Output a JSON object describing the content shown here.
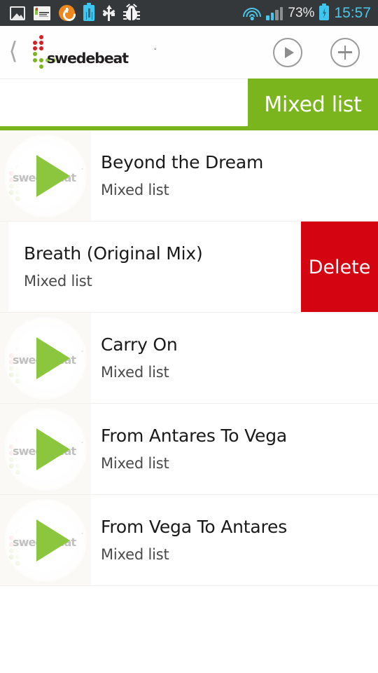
{
  "status_bar": {
    "icons_left": [
      "gallery-icon",
      "screenshot-icon",
      "sync-circle-icon",
      "usb-battery-icon",
      "usb-icon",
      "debug-bug-icon"
    ],
    "wifi": "wifi-icon",
    "signal": {
      "name": "signal-bars-icon",
      "bars_total": 4,
      "bars_filled": 2
    },
    "battery_percent": "73%",
    "battery_icon": "battery-charging-icon",
    "time": "15:57",
    "background": "#34383b",
    "accent": "#4cc6e8"
  },
  "header": {
    "back_icon": "chevron-left-icon",
    "brand": "swedebeat",
    "brand_registered": "°",
    "play_button": "play-circle-icon",
    "add_button": "plus-circle-icon"
  },
  "tabs": {
    "active_label": "Mixed list",
    "accent": "#7ab51d"
  },
  "tracks": [
    {
      "title": "Beyond the Dream",
      "subtitle": "Mixed list",
      "swiped": false
    },
    {
      "title": "Breath (Original Mix)",
      "subtitle": "Mixed list",
      "swiped": true
    },
    {
      "title": "Carry On",
      "subtitle": "Mixed list",
      "swiped": false
    },
    {
      "title": "From Antares To Vega",
      "subtitle": "Mixed list",
      "swiped": false
    },
    {
      "title": "From Vega To Antares",
      "subtitle": "Mixed list",
      "swiped": false
    }
  ],
  "swipe_action": {
    "delete_label": "Delete",
    "delete_color": "#d40511"
  },
  "thumbnail": {
    "watermark": "swedebeat",
    "watermark_registered": "°",
    "play_color": "#8cc63e"
  }
}
